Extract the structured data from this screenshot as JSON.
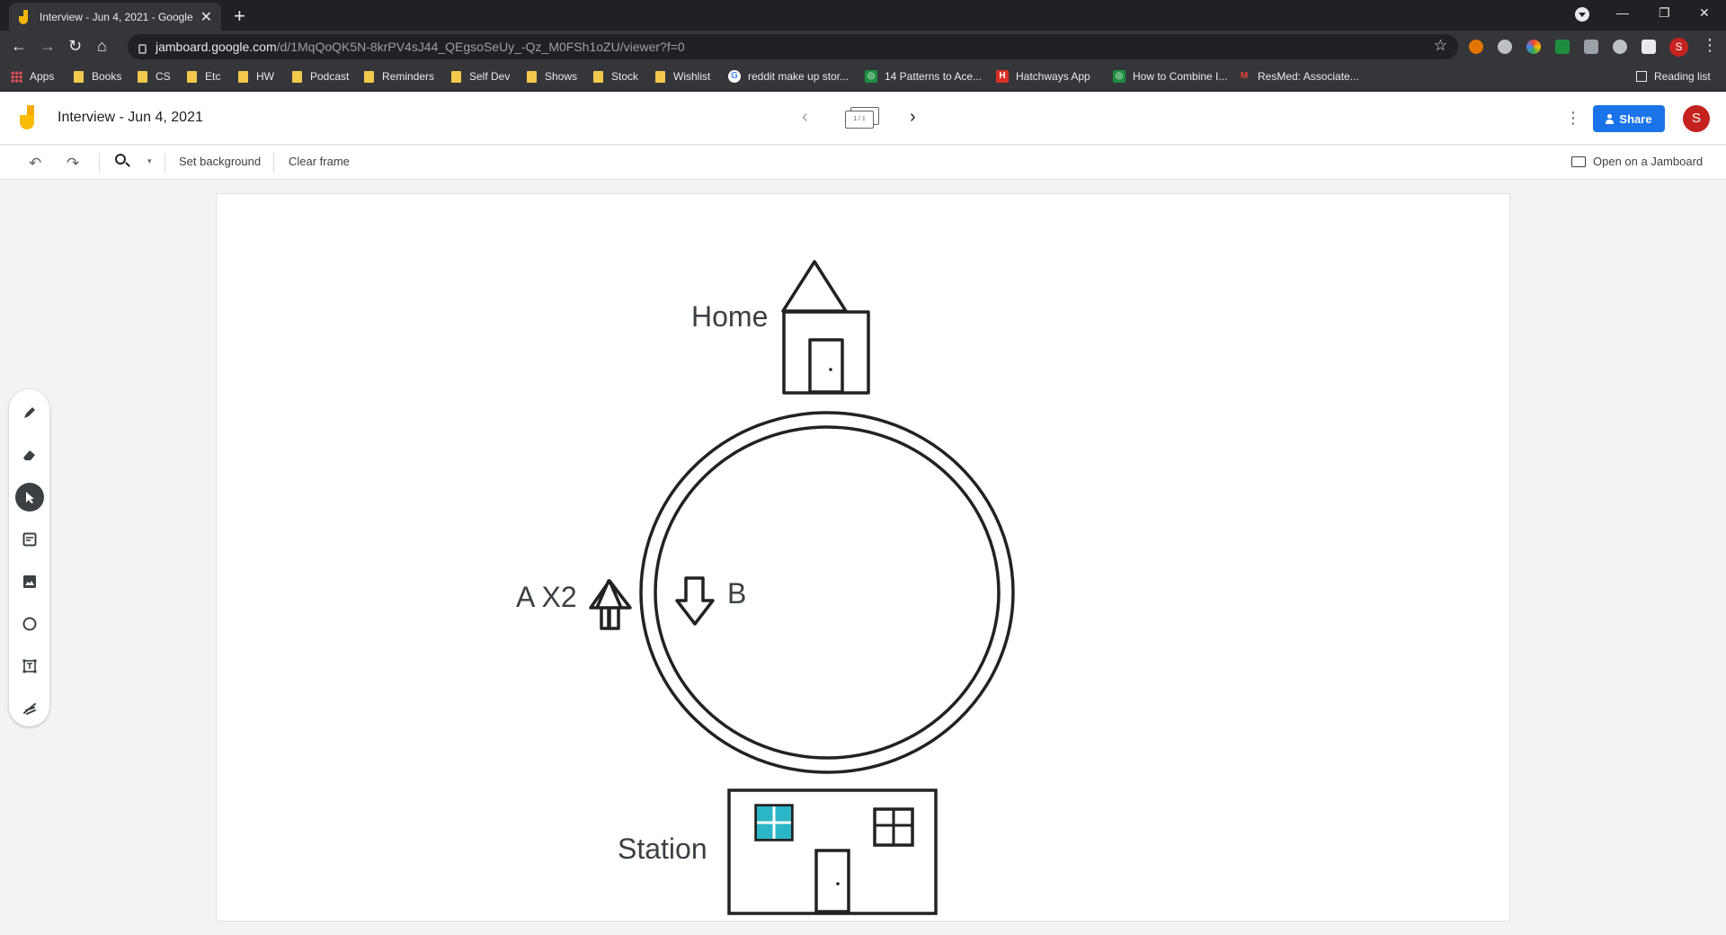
{
  "browser": {
    "tab_title": "Interview - Jun 4, 2021 - Google",
    "tab_close": "✕",
    "new_tab": "+",
    "url_host": "jamboard.google.com",
    "url_path": "/d/1MqQoQK5N-8krPV4sJ44_QEgsoSeUy_-Qz_M0FSh1oZU/viewer?f=0",
    "profile_initial": "S",
    "bookmarks": [
      {
        "label": "Apps",
        "icon": "apps-grid-icon"
      },
      {
        "label": "Books",
        "icon": "folder-icon"
      },
      {
        "label": "CS",
        "icon": "folder-icon"
      },
      {
        "label": "Etc",
        "icon": "folder-icon"
      },
      {
        "label": "HW",
        "icon": "folder-icon"
      },
      {
        "label": "Podcast",
        "icon": "folder-icon"
      },
      {
        "label": "Reminders",
        "icon": "folder-icon"
      },
      {
        "label": "Self Dev",
        "icon": "folder-icon"
      },
      {
        "label": "Shows",
        "icon": "folder-icon"
      },
      {
        "label": "Stock",
        "icon": "folder-icon"
      },
      {
        "label": "Wishlist",
        "icon": "folder-icon"
      },
      {
        "label": "reddit make up stor...",
        "icon": "google-icon"
      },
      {
        "label": "14 Patterns to Ace...",
        "icon": "site-icon"
      },
      {
        "label": "Hatchways App",
        "icon": "hatchways-icon"
      },
      {
        "label": "How to Combine I...",
        "icon": "site-icon"
      },
      {
        "label": "ResMed: Associate...",
        "icon": "gmail-icon"
      }
    ],
    "reading_list": "Reading list"
  },
  "app": {
    "title": "Interview - Jun 4, 2021",
    "frame_indicator": "1 / 1",
    "share_label": "Share",
    "avatar_initial": "S",
    "set_background": "Set background",
    "clear_frame": "Clear frame",
    "open_on_jamboard": "Open on a Jamboard",
    "accent_color": "#1a73e8"
  },
  "canvas": {
    "home_label": "Home",
    "station_label": "Station",
    "a_label": "A X2",
    "b_label": "B"
  },
  "tools": [
    "pen-icon",
    "eraser-icon",
    "select-icon",
    "sticky-note-icon",
    "image-icon",
    "circle-icon",
    "text-box-icon",
    "laser-icon"
  ]
}
